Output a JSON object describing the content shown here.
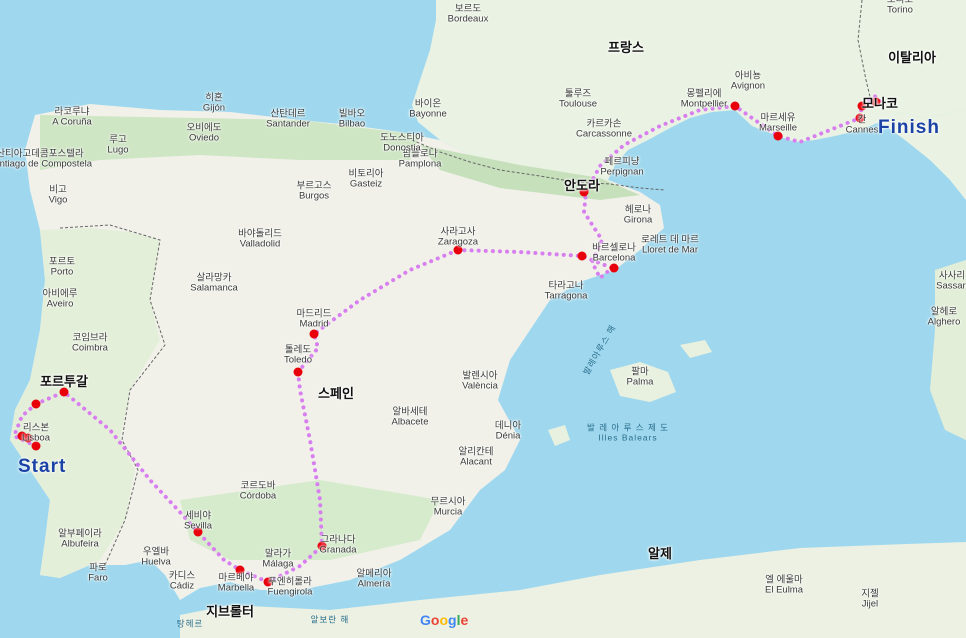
{
  "route": {
    "start_label": "Start",
    "finish_label": "Finish",
    "line_color": "#d87ff0",
    "stop_color": "#e8000b"
  },
  "countries": [
    {
      "name": "프랑스"
    },
    {
      "name": "스페인"
    },
    {
      "name": "포르투갈"
    },
    {
      "name": "안도라"
    },
    {
      "name": "모나코"
    },
    {
      "name": "이탈리아"
    },
    {
      "name": "지브롤터"
    },
    {
      "name": "알제"
    }
  ],
  "cities": [
    {
      "ko": "보르도",
      "en": "Bordeaux"
    },
    {
      "ko": "툴루즈",
      "en": "Toulouse"
    },
    {
      "ko": "몽펠리에",
      "en": "Montpellier"
    },
    {
      "ko": "마르세유",
      "en": "Marseille"
    },
    {
      "ko": "칸",
      "en": "Cannes"
    },
    {
      "ko": "바르셀로나",
      "en": "Barcelona"
    },
    {
      "ko": "사라고사",
      "en": "Zaragoza"
    },
    {
      "ko": "마드리드",
      "en": "Madrid"
    },
    {
      "ko": "톨레도",
      "en": "Toledo"
    },
    {
      "ko": "발렌시아",
      "en": "València"
    },
    {
      "ko": "무르시아",
      "en": "Murcia"
    },
    {
      "ko": "세비야",
      "en": "Sevilla"
    },
    {
      "ko": "말라가",
      "en": "Málaga"
    },
    {
      "ko": "그라나다",
      "en": "Granada"
    },
    {
      "ko": "리스본",
      "en": "Lisboa"
    },
    {
      "ko": "포르토",
      "en": "Porto"
    },
    {
      "ko": "빌바오",
      "en": "Bilbao"
    },
    {
      "ko": "팔마",
      "en": "Palma"
    },
    {
      "ko": "라코루냐",
      "en": "A Coruña"
    },
    {
      "ko": "산탄데르",
      "en": "Santander"
    },
    {
      "ko": "오비에도",
      "en": "Oviedo"
    },
    {
      "ko": "바야돌리드",
      "en": "Valladolid"
    },
    {
      "ko": "살라망카",
      "en": "Salamanca"
    },
    {
      "ko": "부르고스",
      "en": "Burgos"
    },
    {
      "ko": "팜플로나",
      "en": "Pamplona"
    },
    {
      "ko": "알리칸테",
      "en": "Alacant"
    },
    {
      "ko": "코르도바",
      "en": "Córdoba"
    },
    {
      "ko": "타라고나",
      "en": "Tarragona"
    },
    {
      "ko": "페르피냥",
      "en": "Perpignan"
    },
    {
      "ko": "카르카손",
      "en": "Carcassonne"
    },
    {
      "ko": "아비뇽",
      "en": "Avignon"
    },
    {
      "ko": "코임브라",
      "en": "Coimbra"
    },
    {
      "ko": "알메리아",
      "en": "Almería"
    },
    {
      "ko": "마르베야",
      "en": "Marbella"
    },
    {
      "ko": "헤로나",
      "en": "Girona"
    },
    {
      "ko": "알바세테",
      "en": "Albacete"
    },
    {
      "ko": "바이온",
      "en": "Bayonne"
    },
    {
      "ko": "비토리아",
      "en": "Gasteiz"
    },
    {
      "ko": "산티아고데콤포스텔라",
      "en": "Santiago de Compostela"
    },
    {
      "ko": "비고",
      "en": "Vigo"
    },
    {
      "ko": "루고",
      "en": "Lugo"
    },
    {
      "ko": "히혼",
      "en": "Gijón"
    },
    {
      "ko": "알헤로",
      "en": "Alghero"
    },
    {
      "ko": "사사리",
      "en": "Sassari"
    },
    {
      "ko": "토리노",
      "en": "Torino"
    },
    {
      "ko": "카디스",
      "en": "Cádiz"
    },
    {
      "ko": "우엘바",
      "en": "Huelva"
    },
    {
      "ko": "파로",
      "en": "Faro"
    },
    {
      "ko": "알부페이라",
      "en": "Albufeira"
    },
    {
      "ko": "로레트 데 마르",
      "en": "Lloret de Mar"
    },
    {
      "ko": "도노스티아",
      "en": "Donostia"
    },
    {
      "ko": "푸엔히롤라",
      "en": "Fuengirola"
    },
    {
      "ko": "엘 에울마",
      "en": "El Eulma"
    },
    {
      "ko": "지젤",
      "en": "Jijel"
    },
    {
      "ko": "데니아",
      "en": "Dénia"
    },
    {
      "ko": "아비에루",
      "en": "Aveiro"
    }
  ],
  "seas": [
    {
      "name": "발레아루스 해"
    },
    {
      "name": "발 레 아 루 스   제 도"
    },
    {
      "name": "Illes Balears"
    },
    {
      "name": "알보란 해"
    },
    {
      "name": "탕헤르"
    }
  ],
  "attribution": {
    "chars": [
      "G",
      "o",
      "o",
      "g",
      "l",
      "e"
    ]
  }
}
